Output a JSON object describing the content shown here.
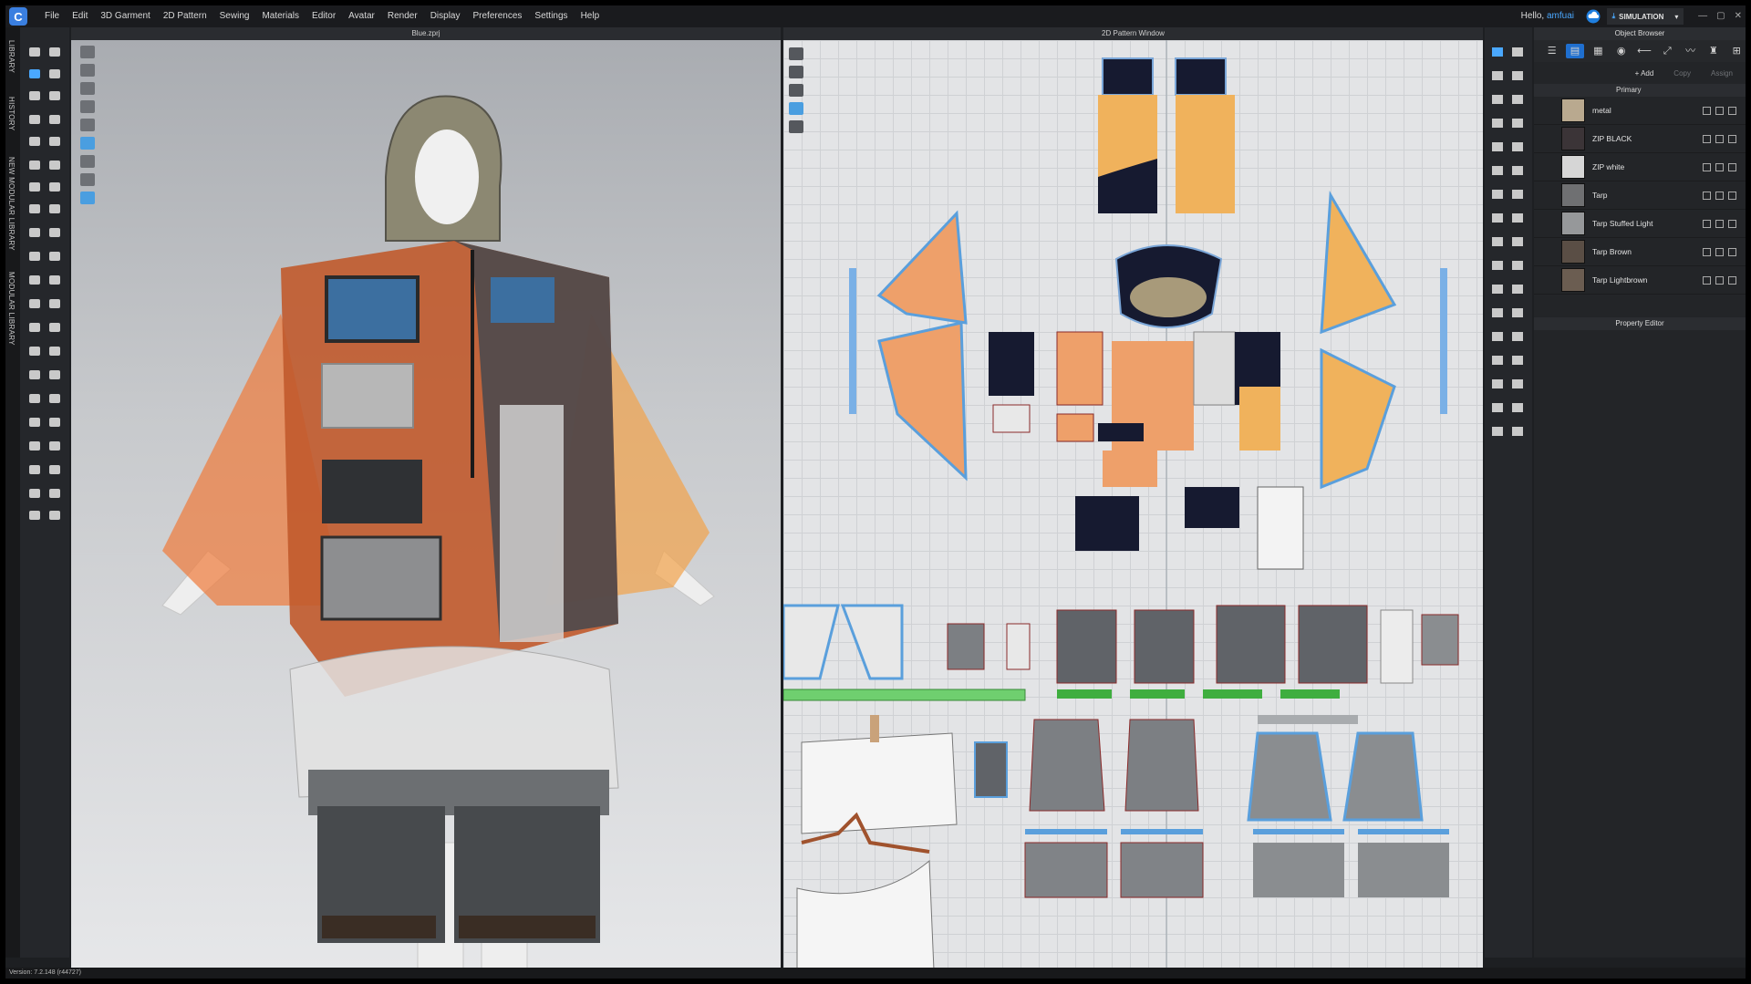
{
  "app": {
    "logo": "C",
    "menu": [
      "File",
      "Edit",
      "3D Garment",
      "2D Pattern",
      "Sewing",
      "Materials",
      "Editor",
      "Avatar",
      "Render",
      "Display",
      "Preferences",
      "Settings",
      "Help"
    ],
    "greeting": "Hello,",
    "username": "amfuai",
    "mode_button": "SIMULATION"
  },
  "side_tabs": [
    "LIBRARY",
    "HISTORY",
    "NEW MODULAR LIBRARY",
    "MODULAR LIBRARY"
  ],
  "viewport3d": {
    "title": "Blue.zprj"
  },
  "viewport2d": {
    "title": "2D Pattern Window"
  },
  "object_browser": {
    "title": "Object Browser",
    "add_label": "+ Add",
    "copy_label": "Copy",
    "assign_label": "Assign",
    "group_label": "Primary",
    "materials": [
      {
        "name": "metal",
        "color": "#b9a98f"
      },
      {
        "name": "ZIP BLACK",
        "color": "#3b3437"
      },
      {
        "name": "ZIP white",
        "color": "#d6d6d6"
      },
      {
        "name": "Tarp",
        "color": "#6f7072"
      },
      {
        "name": "Tarp Stuffed Light",
        "color": "#96989a"
      },
      {
        "name": "Tarp Brown",
        "color": "#5a4e45"
      },
      {
        "name": "Tarp Lightbrown",
        "color": "#6b5d51"
      }
    ]
  },
  "property_editor": {
    "title": "Property Editor"
  },
  "status": {
    "version": "Version: 7.2.148 (r44727)"
  }
}
